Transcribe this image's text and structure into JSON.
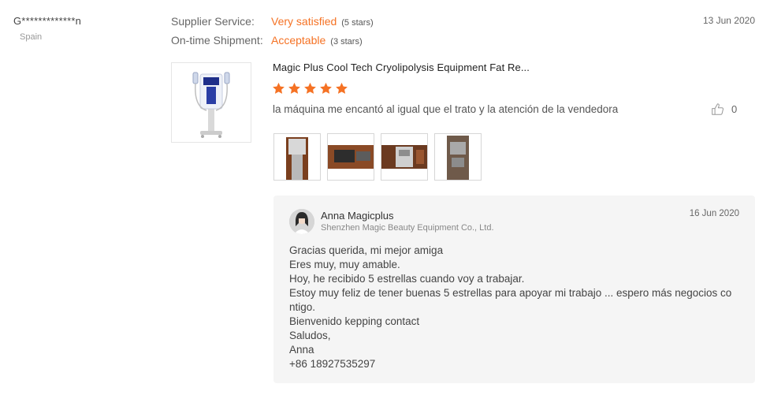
{
  "review": {
    "reviewer_name": "G*************n",
    "reviewer_country": "Spain",
    "date": "13 Jun 2020",
    "ratings": [
      {
        "label": "Supplier Service:",
        "value": "Very satisfied",
        "stars_note": "(5 stars)"
      },
      {
        "label": "On-time Shipment:",
        "value": "Acceptable",
        "stars_note": "(3 stars)"
      }
    ],
    "product_title": "Magic Plus Cool Tech Cryolipolysis Equipment Fat Re...",
    "star_rating": 5,
    "star_color": "#f57224",
    "text": "la máquina me encantó al igual que el trato y la atención de la vendedora",
    "helpful_count": "0",
    "photo_count": 4
  },
  "reply": {
    "seller_name": "Anna Magicplus",
    "company": "Shenzhen Magic Beauty Equipment Co., Ltd.",
    "date": "16 Jun 2020",
    "lines": [
      "Gracias querida, mi mejor amiga",
      "Eres muy, muy amable.",
      "Hoy, he recibido 5 estrellas cuando voy a trabajar.",
      "Estoy muy feliz de tener buenas 5 estrellas para apoyar mi trabajo ... espero más negocios co",
      "ntigo.",
      "Bienvenido kepping contact",
      "Saludos,",
      "Anna",
      "+86 18927535297"
    ]
  }
}
